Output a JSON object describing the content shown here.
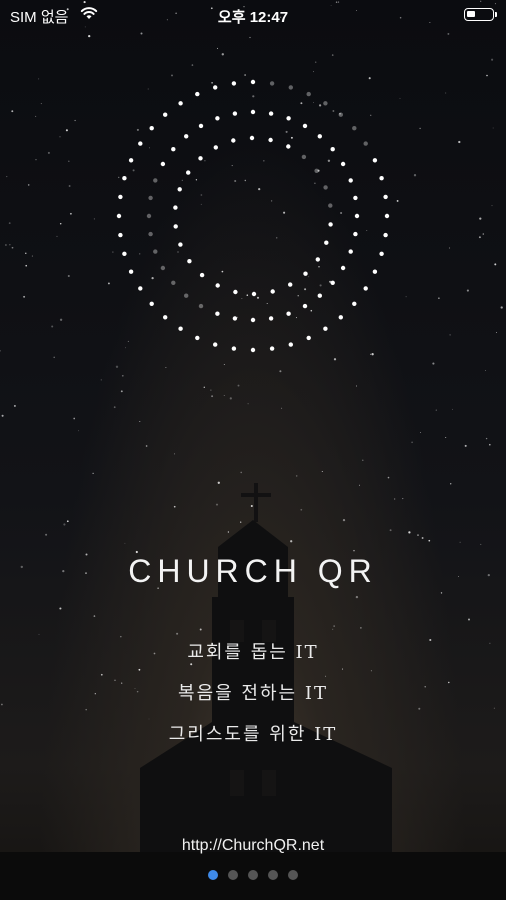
{
  "status_bar": {
    "carrier": "SIM 없음",
    "time": "오후 12:47"
  },
  "splash": {
    "title": "CHURCH QR",
    "slogans": [
      "교회를 돕는 IT",
      "복음을 전하는 IT",
      "그리스도를 위한 IT"
    ],
    "url": "http://ChurchQR.net"
  },
  "pager": {
    "count": 5,
    "active_index": 0,
    "active_color": "#3f8ae8",
    "inactive_color": "#555555"
  }
}
